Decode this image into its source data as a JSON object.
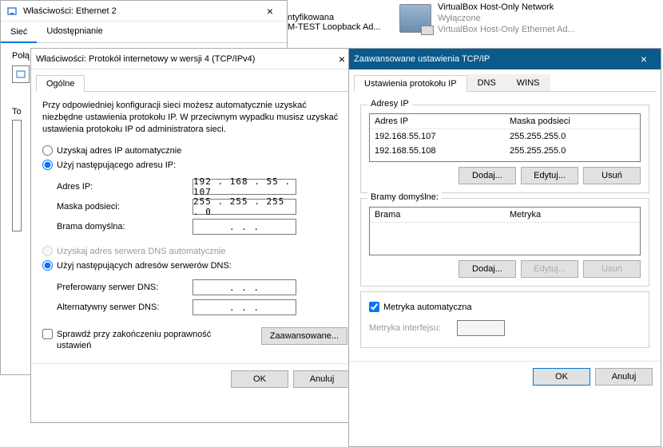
{
  "background": {
    "connName": "VirtualBox Host-Only Network",
    "connStatus": "Wyłączone",
    "connDevice": "VirtualBox Host-Only Ethernet Ad...",
    "partialLine1": "ntyfikowana",
    "partialLine2": "M-TEST Loopback Ad..."
  },
  "ethWin": {
    "title": "Właściwości: Ethernet 2",
    "tabs": [
      "Sieć",
      "Udostępnianie"
    ],
    "connectLabelPartial": "Połą",
    "thisLabel": "To"
  },
  "ipv4Win": {
    "title": "Właściwości: Protokół internetowy w wersji 4 (TCP/IPv4)",
    "tab": "Ogólne",
    "note": "Przy odpowiedniej konfiguracji sieci możesz automatycznie uzyskać niezbędne ustawienia protokołu IP. W przeciwnym wypadku musisz uzyskać ustawienia protokołu IP od administratora sieci.",
    "radioAuto": "Uzyskaj adres IP automatycznie",
    "radioManual": "Użyj następującego adresu IP:",
    "labelIP": "Adres IP:",
    "valueIP": "192 . 168 .  55  . 107",
    "labelMask": "Maska podsieci:",
    "valueMask": "255 . 255 . 255 .   0",
    "labelGateway": "Brama domyślna:",
    "valueGateway": ".         .         .",
    "radioDnsAuto": "Uzyskaj adres serwera DNS automatycznie",
    "radioDnsManual": "Użyj następujących adresów serwerów DNS:",
    "labelDns1": "Preferowany serwer DNS:",
    "valueDns1": ".         .         .",
    "labelDns2": "Alternatywny serwer DNS:",
    "valueDns2": ".         .         .",
    "checkValidate": "Sprawdź przy zakończeniu poprawność ustawień",
    "btnAdvanced": "Zaawansowane...",
    "btnOK": "OK",
    "btnCancel": "Anuluj"
  },
  "advWin": {
    "title": "Zaawansowane ustawienia TCP/IP",
    "tabs": [
      "Ustawienia protokołu IP",
      "DNS",
      "WINS"
    ],
    "groupIP": "Adresy IP",
    "headIP": "Adres IP",
    "headMask": "Maska podsieci",
    "rows": [
      {
        "ip": "192.168.55.107",
        "mask": "255.255.255.0"
      },
      {
        "ip": "192.168.55.108",
        "mask": "255.255.255.0"
      }
    ],
    "btnAdd": "Dodaj...",
    "btnEdit": "Edytuj...",
    "btnDel": "Usuń",
    "groupGW": "Bramy domyślne:",
    "headGW": "Brama",
    "headMetric": "Metryka",
    "checkAutoMetric": "Metryka automatyczna",
    "labelIfMetric": "Metryka interfejsu:",
    "btnOK": "OK",
    "btnCancel": "Anuluj"
  }
}
